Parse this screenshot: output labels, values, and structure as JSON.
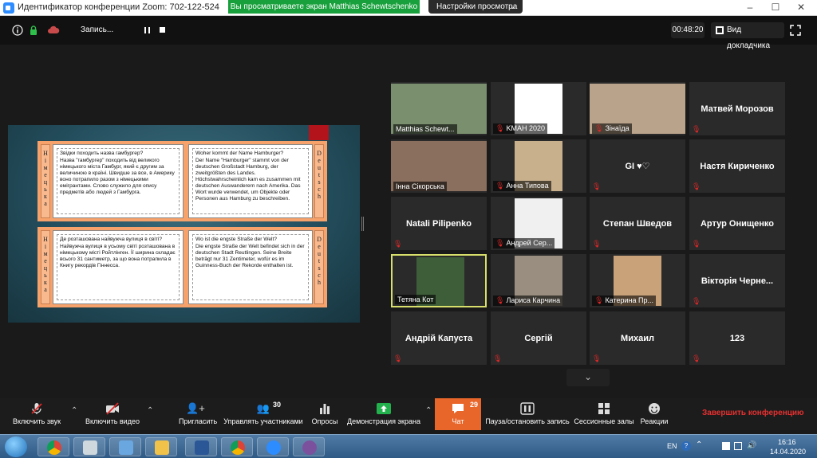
{
  "window": {
    "title": "Идентификатор конференции Zoom: 702-122-524",
    "viewing_banner": "Вы просматриваете экран Matthias Schewtschenko",
    "view_settings": "Настройки просмотра",
    "minimize": "–",
    "maximize": "☐",
    "close": "✕"
  },
  "topbar": {
    "recording_label": "Запись...",
    "timer": "00:48:20",
    "speaker_view": "Вид докладчика"
  },
  "share": {
    "rows": [
      {
        "left_label": "Німецька",
        "right_label": "Deutsch",
        "uk_question": "Звідки походить назва гамбургер?",
        "uk_text": "Назва \"гамбургер\" походить від великого німецького міста Гамбург, який є другим за величиною в країні. Швидше за все, в Америку воно потрапило разом з німецькими емігрантами. Слово служило для опису предметів або людей з Гамбурга.",
        "de_question": "Woher kommt der Name Hamburger?",
        "de_text": "Der Name \"Hamburger\" stammt von der deutschen Großstadt Hamburg, der zweitgrößten des Landes. Höchstwahrscheinlich kam es zusammen mit deutschen Auswanderern nach Amerika. Das Wort wurde verwendet, um Objekte oder Personen aus Hamburg zu beschreiben."
      },
      {
        "left_label": "Німецька",
        "right_label": "Deutsch",
        "uk_question": "Де розташована найвужча вулиця в світі?",
        "uk_text": "Найвужча вулиця в усьому світі розташована в німецькому місті Ройтлінген. Її ширина складає всього 31 сантиметр, за що вона потрапила в Книгу рекордів Гіннесса.",
        "de_question": "Wo ist die engste Straße der Welt?",
        "de_text": "Die engste Straße der Welt befindet sich in der deutschen Stadt Reutlingen. Seine Breite beträgt nur 31 Zentimeter, wofür es im Guinness-Buch der Rekorde enthalten ist."
      }
    ]
  },
  "participants": [
    {
      "name": "Matthias Schewt...",
      "has_video": true,
      "muted": false
    },
    {
      "name": "KMAH 2020",
      "has_video": true,
      "muted": true
    },
    {
      "name": "Зінаїда",
      "has_video": true,
      "muted": true
    },
    {
      "name": "Матвей Морозов",
      "has_video": false,
      "muted": true
    },
    {
      "name": "Інна Сікорська",
      "has_video": true,
      "muted": false
    },
    {
      "name": "Анна Типова",
      "has_video": true,
      "muted": true
    },
    {
      "name": "GI ♥♡",
      "has_video": false,
      "muted": true
    },
    {
      "name": "Настя Кириченко",
      "has_video": false,
      "muted": true
    },
    {
      "name": "Natali Pilipenko",
      "has_video": false,
      "muted": true
    },
    {
      "name": "Андрей Сер...",
      "has_video": true,
      "muted": true
    },
    {
      "name": "Степан Шведов",
      "has_video": false,
      "muted": true
    },
    {
      "name": "Артур Онищенко",
      "has_video": false,
      "muted": true
    },
    {
      "name": "Тетяна Кот",
      "has_video": true,
      "muted": false
    },
    {
      "name": "Лариса Карчина",
      "has_video": true,
      "muted": true
    },
    {
      "name": "Катерина Пр...",
      "has_video": true,
      "muted": true
    },
    {
      "name": "Вікторія Черне...",
      "has_video": false,
      "muted": true
    },
    {
      "name": "Андрій Капуста",
      "has_video": false,
      "muted": true
    },
    {
      "name": "Сергій",
      "has_video": false,
      "muted": true
    },
    {
      "name": "Михаил",
      "has_video": false,
      "muted": true
    },
    {
      "name": "123",
      "has_video": false,
      "muted": true
    }
  ],
  "toolbar": {
    "unmute": "Включить звук",
    "start_video": "Включить видео",
    "invite": "Пригласить",
    "participants": "Управлять участниками",
    "participants_count": "30",
    "polls": "Опросы",
    "share_screen": "Демонстрация экрана",
    "chat": "Чат",
    "chat_count": "29",
    "pause_record": "Пауза/остановить запись",
    "breakout": "Сессионные залы",
    "reactions": "Реакции",
    "end_meeting": "Завершить конференцию"
  },
  "taskbar": {
    "language": "EN",
    "time": "16:16",
    "date": "14.04.2020"
  },
  "colors": {
    "zoom_blue": "#2d8cff",
    "banner_green": "#18a03c",
    "chat_orange": "#e9662a",
    "end_red": "#e63030",
    "active_speaker": "#d8e06b"
  }
}
